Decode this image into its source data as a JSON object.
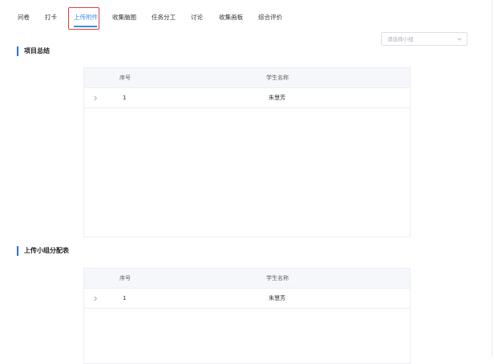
{
  "tabs": [
    {
      "label": "问卷"
    },
    {
      "label": "打卡"
    },
    {
      "label": "上传附件"
    },
    {
      "label": "收集脑图"
    },
    {
      "label": "任务分工"
    },
    {
      "label": "讨论"
    },
    {
      "label": "收集画板"
    },
    {
      "label": "综合评价"
    }
  ],
  "active_tab": "上传附件",
  "group_select": {
    "placeholder": "请选择小组"
  },
  "sections": [
    {
      "title": "项目总结",
      "table": {
        "columns": [
          "序号",
          "学生名称"
        ],
        "rows": [
          {
            "index": "1",
            "student_name": "朱慧芳"
          }
        ]
      }
    },
    {
      "title": "上传小组分配表",
      "table": {
        "columns": [
          "序号",
          "学生名称"
        ],
        "rows": [
          {
            "index": "1",
            "student_name": "朱慧芳"
          }
        ]
      }
    }
  ],
  "colors": {
    "accent": "#3a8ee6",
    "highlight_box": "#e23b3b",
    "section_bar": "#2f6fd6",
    "table_header_bg": "#f5f7fa"
  }
}
